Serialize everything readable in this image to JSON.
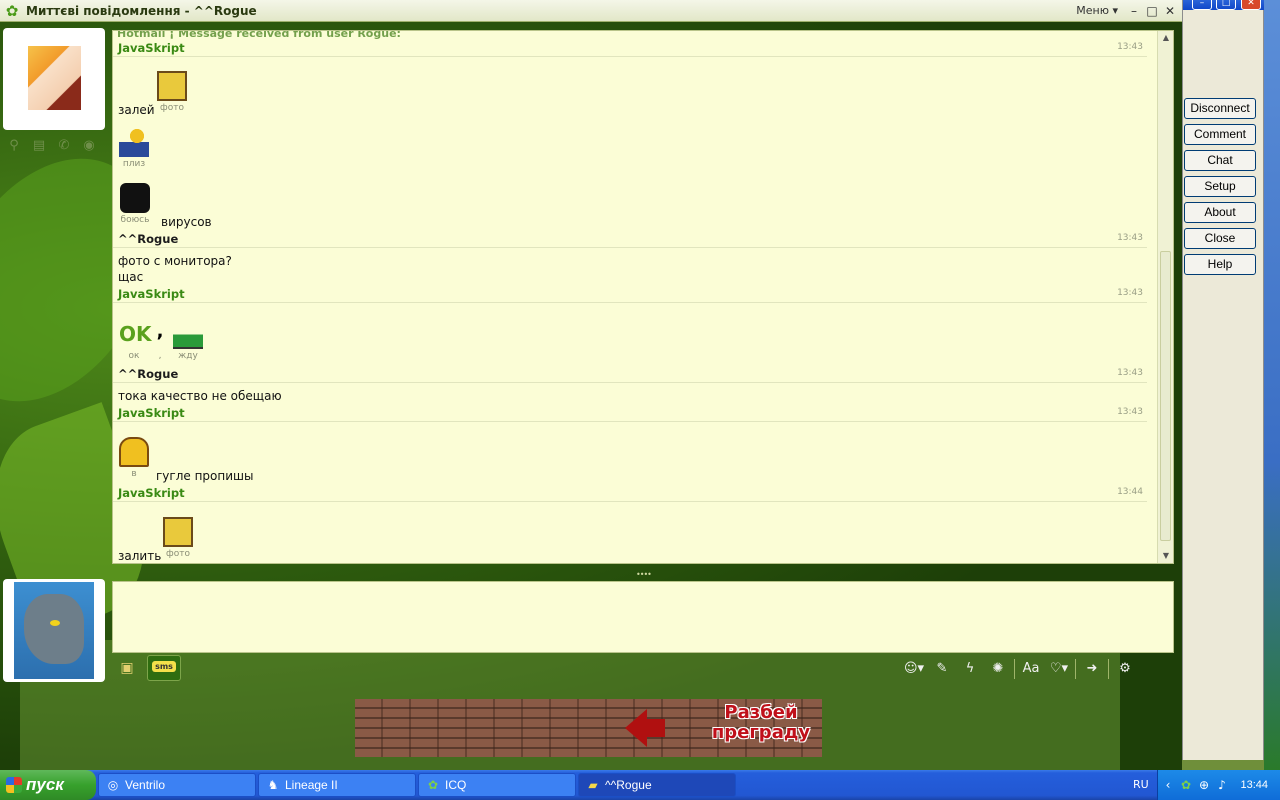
{
  "window": {
    "title": "Миттєві повідомлення - ^^Rogue",
    "menu_label": "Меню ▾",
    "minimize": "–",
    "maximize": "□",
    "close": "✕"
  },
  "chat": {
    "truncated_top": "Hotmail ¡ Message received from user Rogue:",
    "messages": [
      {
        "sender": "JavaSkript",
        "time": "13:43",
        "me": true
      },
      {
        "sender": "^^Rogue",
        "time": "13:43",
        "me": false
      },
      {
        "sender": "JavaSkript",
        "time": "13:43",
        "me": true
      },
      {
        "sender": "^^Rogue",
        "time": "13:43",
        "me": false
      },
      {
        "sender": "JavaSkript",
        "time": "13:43",
        "me": true
      },
      {
        "sender": "JavaSkript",
        "time": "13:44",
        "me": true
      }
    ],
    "text_1": "залей",
    "emoji_1": "фото",
    "emoji_2": "плиз",
    "emoji_3": "боюсь",
    "text_2": "вирусов",
    "text_3": "фото с монитора?",
    "text_4": "щас",
    "emoji_4": "ок",
    "emoji_5": ",",
    "emoji_6": "жду",
    "text_5": "тока качество не обещаю",
    "emoji_7": "в",
    "text_6": "гугле пропишы",
    "text_7": "залить",
    "emoji_8": "фото"
  },
  "input": {
    "sms_label": "sms"
  },
  "banner": {
    "text": "Разбей преграду"
  },
  "side_panel": {
    "buttons": [
      "Disconnect",
      "Comment",
      "Chat",
      "Setup",
      "About",
      "Close",
      "Help"
    ]
  },
  "taskbar": {
    "start_label": "пуск",
    "tasks": [
      {
        "label": "Ventrilo",
        "icon": "ventrilo-icon",
        "active": false
      },
      {
        "label": "Lineage II",
        "icon": "lineage-icon",
        "active": false
      },
      {
        "label": "ICQ",
        "icon": "icq-flower-icon",
        "active": false
      },
      {
        "label": "^^Rogue",
        "icon": "chat-folder-icon",
        "active": true
      }
    ],
    "language": "RU",
    "clock": "13:44"
  },
  "colors": {
    "own_name": "#3a8a14",
    "peer_name": "#1c1c1c",
    "chat_bg": "#fbfdd6",
    "banner_text": "#c0101a"
  }
}
